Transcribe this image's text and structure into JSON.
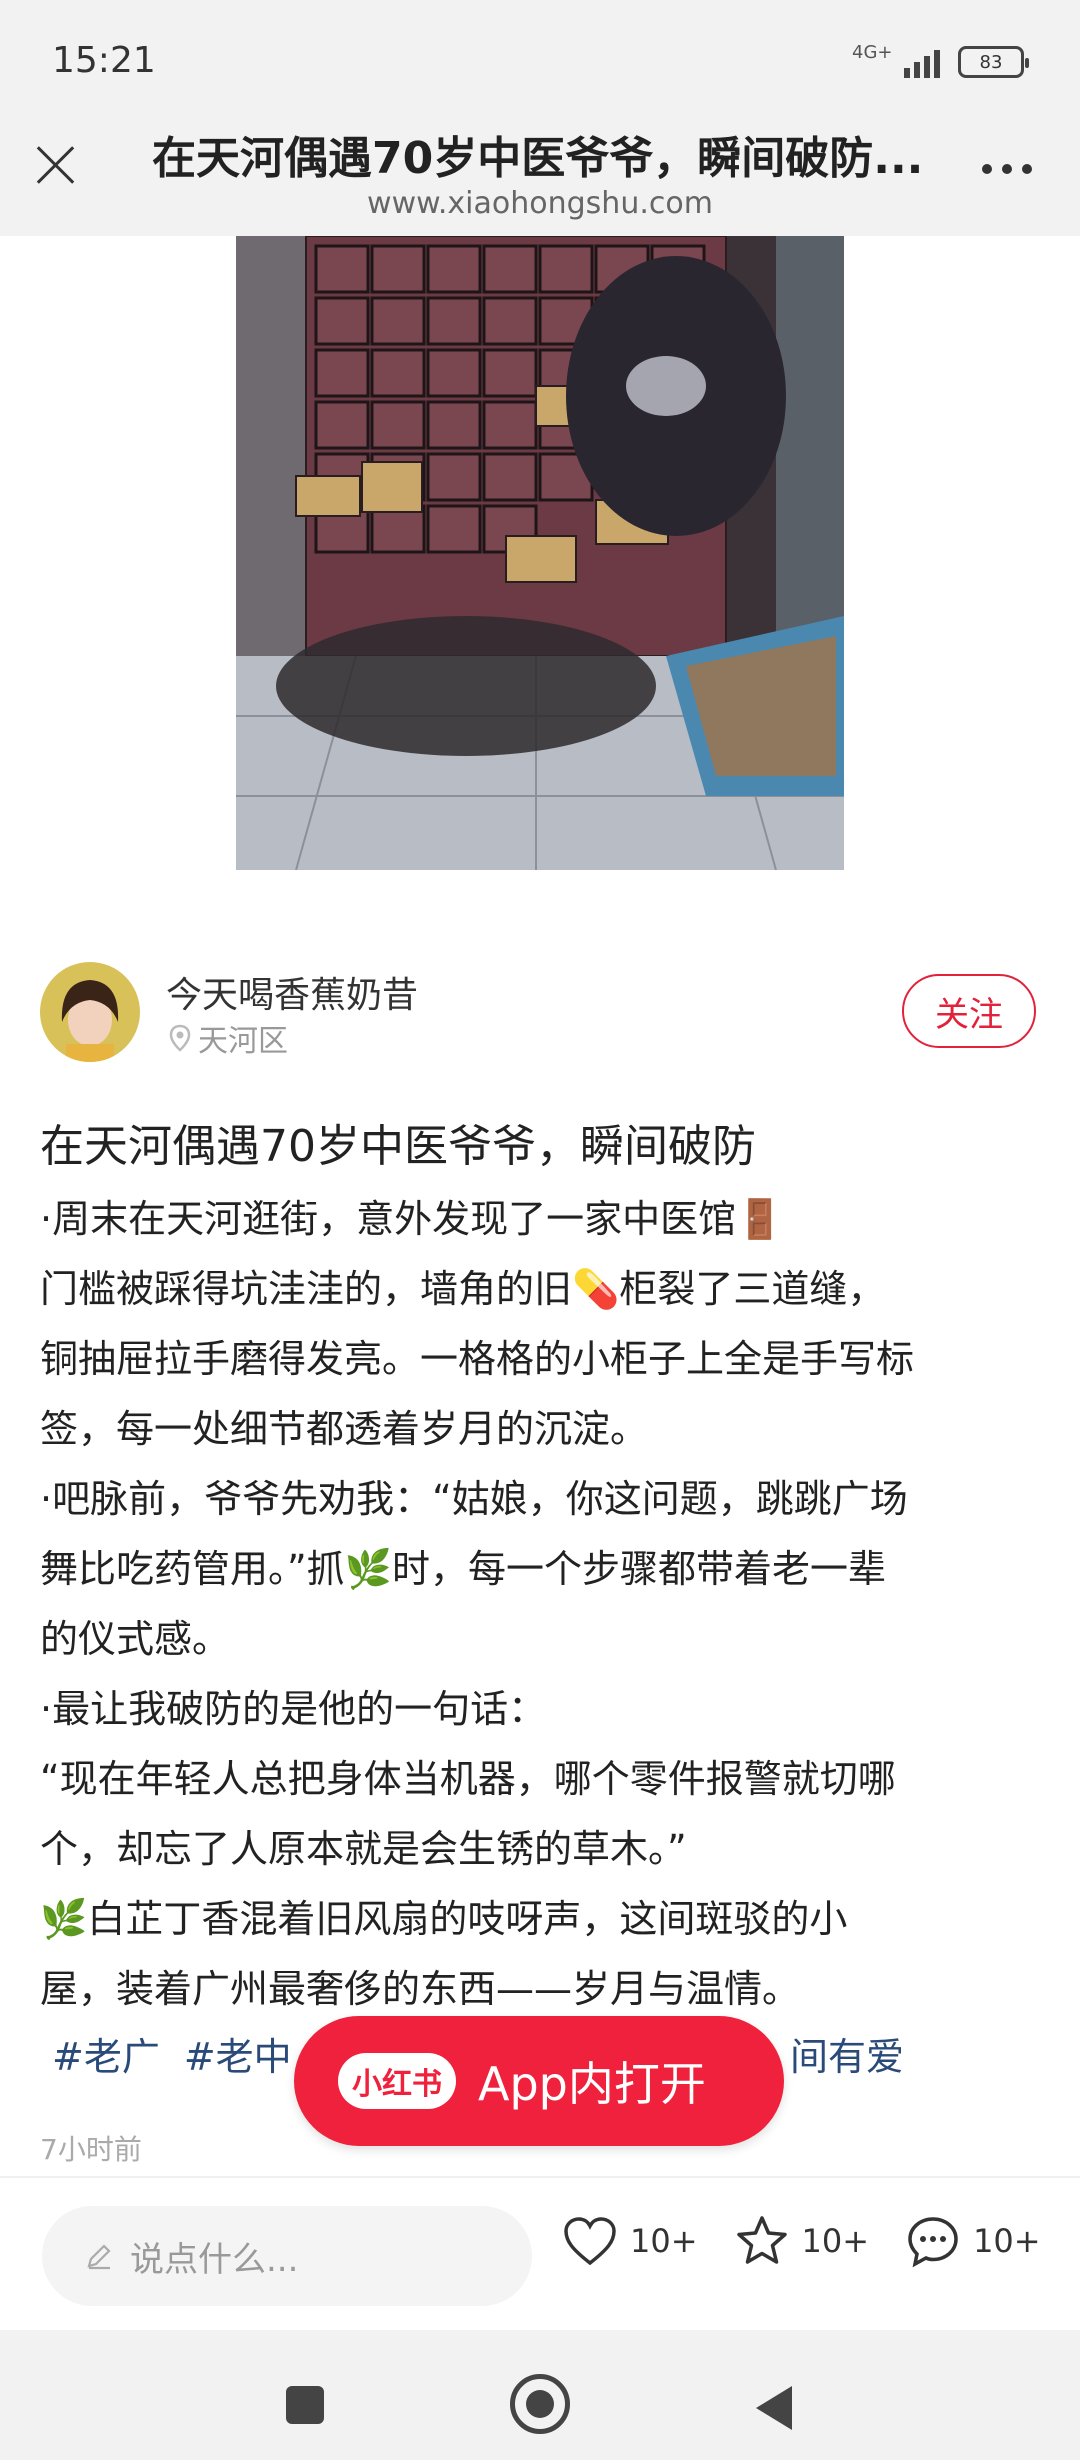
{
  "status_bar": {
    "time": "15:21",
    "network": "4G+",
    "battery": "83"
  },
  "header": {
    "title": "在天河偶遇70岁中医爷爷，瞬间破防...",
    "url": "www.xiaohongshu.com"
  },
  "author": {
    "name": "今天喝香蕉奶昔",
    "location": "天河区",
    "follow_label": "关注"
  },
  "note": {
    "title": "在天河偶遇70岁中医爷爷，瞬间破防",
    "lines": [
      "·周末在天河逛街，意外发现了一家中医馆🚪",
      "门槛被踩得坑洼洼的，墙角的旧💊柜裂了三道缝，",
      "铜抽屉拉手磨得发亮。一格格的小柜子上全是手写标",
      "签，每一处细节都透着岁月的沉淀。",
      "·吧脉前，爷爷先劝我：“姑娘，你这问题，跳跳广场",
      "舞比吃药管用。”抓🌿时，每一个步骤都带着老一辈",
      "的仪式感。",
      "·最让我破防的是他的一句话：",
      "“现在年轻人总把身体当机器，哪个零件报警就切哪",
      "个，却忘了人原本就是会生锈的草木。”",
      "🌿白芷丁香混着旧风扇的吱呀声，这间斑驳的小",
      "屋，装着广州最奢侈的东西——岁月与温情。"
    ],
    "tags": [
      "#老广",
      "#老中"
    ],
    "tag_tail": "间有爱",
    "time_ago": "7小时前"
  },
  "open_app": {
    "logo": "小红书",
    "label": "App内打开"
  },
  "bottom_bar": {
    "comment_placeholder": "说点什么...",
    "likes": "10+",
    "collects": "10+",
    "comments": "10+"
  },
  "icons": {
    "close": "close-icon",
    "more": "more-icon",
    "location": "location-pin-icon",
    "pen": "pen-icon",
    "like": "heart-icon",
    "collect": "star-icon",
    "comment": "comment-icon"
  },
  "colors": {
    "brand": "#f0213d",
    "follow": "#e2223b",
    "tag": "#2a4a7a"
  }
}
